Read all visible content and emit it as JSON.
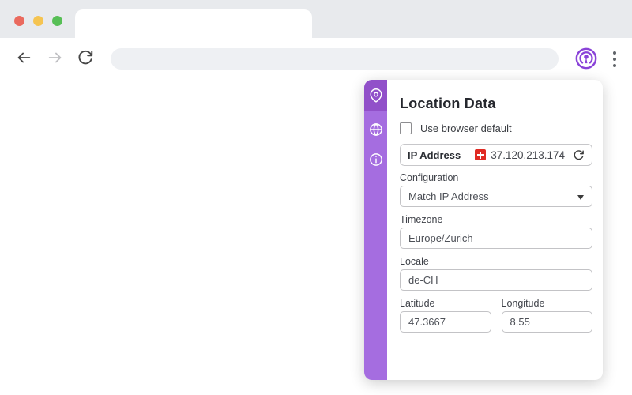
{
  "browser": {
    "window_controls": {
      "close": "close",
      "minimize": "minimize",
      "maximize": "maximize"
    },
    "nav": {
      "back": "back",
      "forward": "forward",
      "reload": "reload"
    },
    "address_bar": {
      "value": ""
    },
    "extension": {
      "name": "location-spoof-extension",
      "color": "#8a43d8"
    },
    "menu": "more-options"
  },
  "popup": {
    "accent_color": "#9a5fd5",
    "sidebar": {
      "bg_color": "#a56de0",
      "active_bg_color": "#9150c9",
      "items": [
        {
          "icon": "location-pin-icon",
          "active": true
        },
        {
          "icon": "globe-icon",
          "active": false
        },
        {
          "icon": "info-icon",
          "active": false
        }
      ]
    },
    "title": "Location Data",
    "use_default": {
      "label": "Use browser default",
      "checked": false
    },
    "ip": {
      "label": "IP Address",
      "flag": "swiss-flag",
      "flag_color": "#e02a23",
      "value": "37.120.213.174"
    },
    "fields": [
      {
        "label": "Configuration",
        "value": "Match IP Address",
        "control": "select"
      },
      {
        "label": "Timezone",
        "value": "Europe/Zurich",
        "control": "input"
      },
      {
        "label": "Locale",
        "value": "de-CH",
        "control": "input"
      }
    ],
    "coords": [
      {
        "label": "Latitude",
        "value": "47.3667"
      },
      {
        "label": "Longitude",
        "value": "8.55"
      }
    ]
  }
}
